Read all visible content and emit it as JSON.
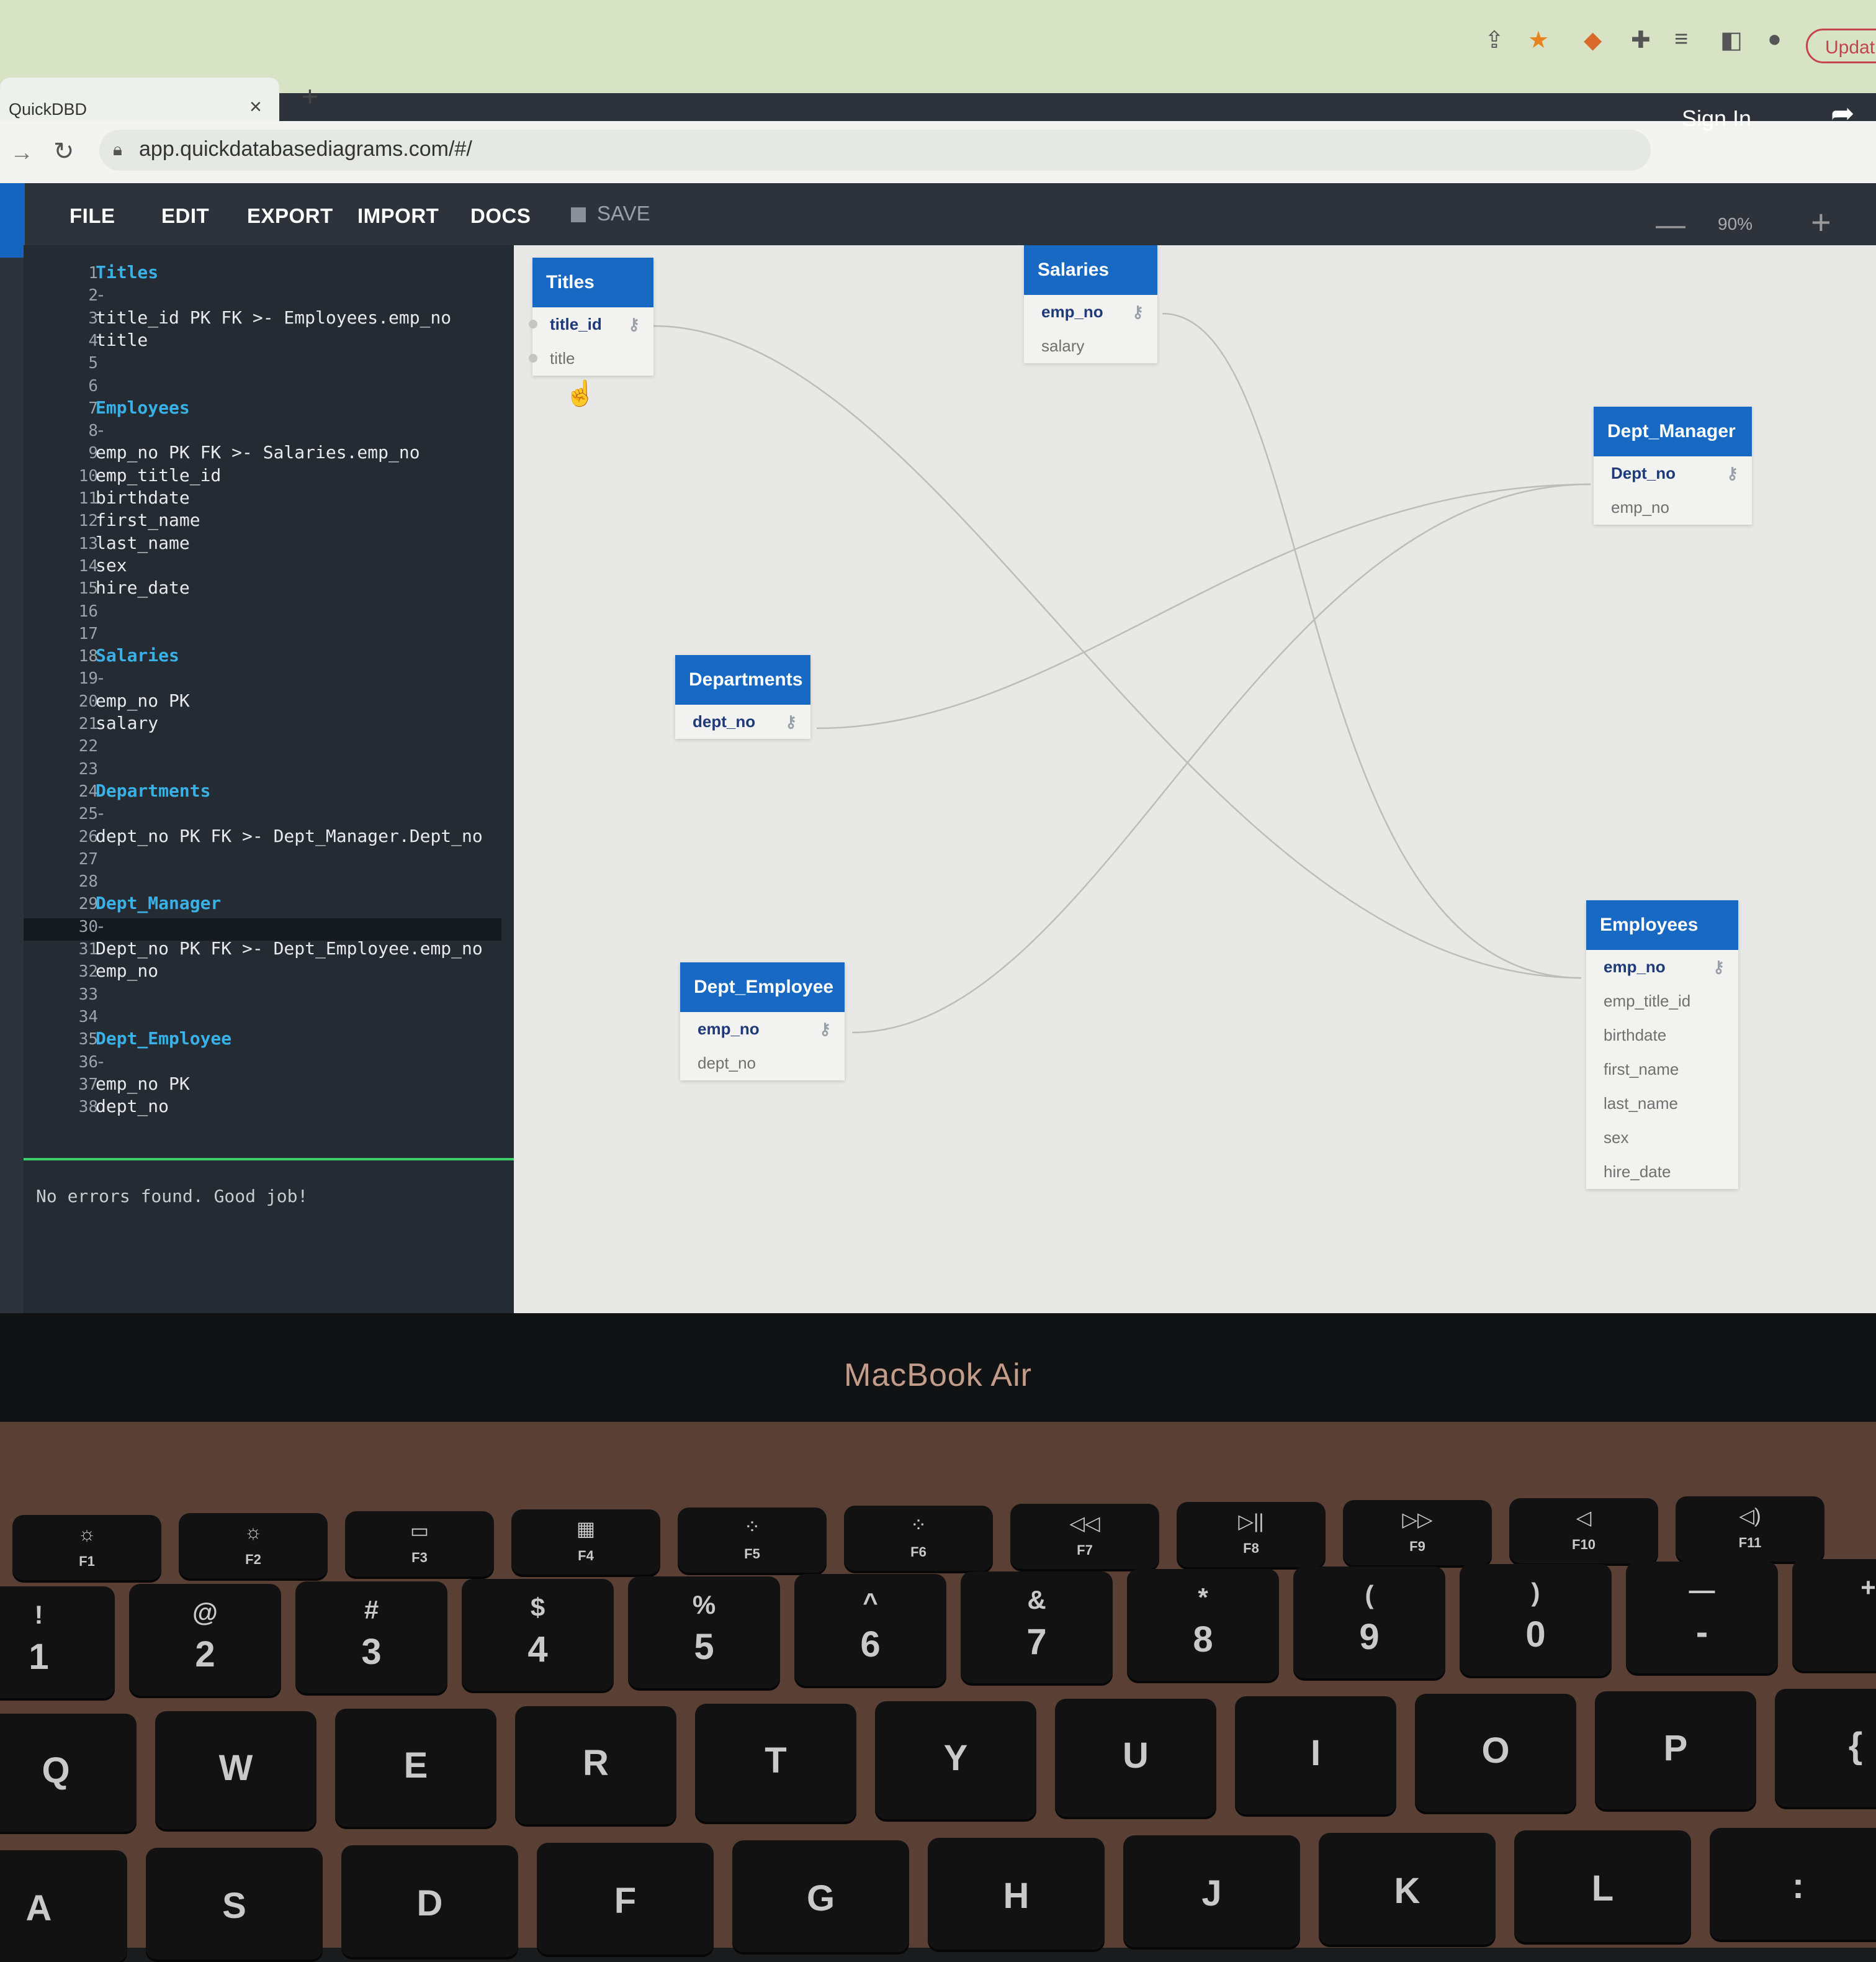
{
  "browser": {
    "tab_title": "QuickDBD",
    "tab_close": "×",
    "new_tab": "+",
    "url": "app.quickdatabasediagrams.com/#/",
    "update_label": "Updat"
  },
  "app": {
    "menu": {
      "file": "FILE",
      "edit": "EDIT",
      "export": "EXPORT",
      "import": "IMPORT",
      "docs": "DOCS",
      "save": "SAVE"
    },
    "sign_in": "Sign In",
    "zoom": {
      "level": "90%",
      "minus": "—",
      "plus": "+"
    }
  },
  "editor": {
    "lines": [
      {
        "n": "1",
        "text": "Titles",
        "type": "table"
      },
      {
        "n": "2",
        "text": "-",
        "type": "dim"
      },
      {
        "n": "3",
        "text": "title_id PK FK >- Employees.emp_no",
        "type": "code"
      },
      {
        "n": "4",
        "text": "title",
        "type": "code"
      },
      {
        "n": "5",
        "text": "",
        "type": "code"
      },
      {
        "n": "6",
        "text": "",
        "type": "code"
      },
      {
        "n": "7",
        "text": "Employees",
        "type": "table"
      },
      {
        "n": "8",
        "text": "-",
        "type": "dim"
      },
      {
        "n": "9",
        "text": "emp_no PK FK >- Salaries.emp_no",
        "type": "code"
      },
      {
        "n": "10",
        "text": "emp_title_id",
        "type": "code"
      },
      {
        "n": "11",
        "text": "birthdate",
        "type": "code"
      },
      {
        "n": "12",
        "text": "first_name",
        "type": "code"
      },
      {
        "n": "13",
        "text": "last_name",
        "type": "code"
      },
      {
        "n": "14",
        "text": "sex",
        "type": "code"
      },
      {
        "n": "15",
        "text": "hire_date",
        "type": "code"
      },
      {
        "n": "16",
        "text": "",
        "type": "code"
      },
      {
        "n": "17",
        "text": "",
        "type": "code"
      },
      {
        "n": "18",
        "text": "Salaries",
        "type": "table"
      },
      {
        "n": "19",
        "text": "-",
        "type": "dim"
      },
      {
        "n": "20",
        "text": "emp_no PK",
        "type": "code"
      },
      {
        "n": "21",
        "text": "salary",
        "type": "code"
      },
      {
        "n": "22",
        "text": "",
        "type": "code"
      },
      {
        "n": "23",
        "text": "",
        "type": "code"
      },
      {
        "n": "24",
        "text": "Departments",
        "type": "table"
      },
      {
        "n": "25",
        "text": "-",
        "type": "dim"
      },
      {
        "n": "26",
        "text": "dept_no PK FK >- Dept_Manager.Dept_no",
        "type": "code"
      },
      {
        "n": "27",
        "text": "",
        "type": "code"
      },
      {
        "n": "28",
        "text": "",
        "type": "code"
      },
      {
        "n": "29",
        "text": "Dept_Manager",
        "type": "table"
      },
      {
        "n": "30",
        "text": "-",
        "type": "dim"
      },
      {
        "n": "31",
        "text": "Dept_no PK FK >- Dept_Employee.emp_no",
        "type": "code"
      },
      {
        "n": "32",
        "text": "emp_no",
        "type": "code"
      },
      {
        "n": "33",
        "text": "",
        "type": "code"
      },
      {
        "n": "34",
        "text": "",
        "type": "code"
      },
      {
        "n": "35",
        "text": "Dept_Employee",
        "type": "table"
      },
      {
        "n": "36",
        "text": "-",
        "type": "dim"
      },
      {
        "n": "37",
        "text": "emp_no PK",
        "type": "code"
      },
      {
        "n": "38",
        "text": "dept_no",
        "type": "code"
      }
    ],
    "status": "No errors found. Good job!"
  },
  "diagram": {
    "titles": {
      "name": "Titles",
      "fields": [
        {
          "name": "title_id",
          "pk": true
        },
        {
          "name": "title",
          "pk": false
        }
      ]
    },
    "salaries": {
      "name": "Salaries",
      "fields": [
        {
          "name": "emp_no",
          "pk": true
        },
        {
          "name": "salary",
          "pk": false
        }
      ]
    },
    "dept_manager": {
      "name": "Dept_Manager",
      "fields": [
        {
          "name": "Dept_no",
          "pk": true
        },
        {
          "name": "emp_no",
          "pk": false
        }
      ]
    },
    "departments": {
      "name": "Departments",
      "fields": [
        {
          "name": "dept_no",
          "pk": true
        }
      ]
    },
    "dept_employee": {
      "name": "Dept_Employee",
      "fields": [
        {
          "name": "emp_no",
          "pk": true
        },
        {
          "name": "dept_no",
          "pk": false
        }
      ]
    },
    "employees": {
      "name": "Employees",
      "fields": [
        {
          "name": "emp_no",
          "pk": true
        },
        {
          "name": "emp_title_id",
          "pk": false
        },
        {
          "name": "birthdate",
          "pk": false
        },
        {
          "name": "first_name",
          "pk": false
        },
        {
          "name": "last_name",
          "pk": false
        },
        {
          "name": "sex",
          "pk": false
        },
        {
          "name": "hire_date",
          "pk": false
        }
      ]
    }
  },
  "laptop": {
    "brand": "MacBook Air",
    "fn_keys": [
      "F1",
      "F2",
      "F3",
      "F4",
      "F5",
      "F6",
      "F7",
      "F8",
      "F9",
      "F10",
      "F11"
    ],
    "fn_glyphs": [
      "☼",
      "☼",
      "▭",
      "▦",
      "⁘",
      "⁘",
      "◁◁",
      "▷||",
      "▷▷",
      "◁",
      "◁)"
    ],
    "number_keys": [
      {
        "top": "!",
        "main": "1"
      },
      {
        "top": "@",
        "main": "2"
      },
      {
        "top": "#",
        "main": "3"
      },
      {
        "top": "$",
        "main": "4"
      },
      {
        "top": "%",
        "main": "5"
      },
      {
        "top": "^",
        "main": "6"
      },
      {
        "top": "&",
        "main": "7"
      },
      {
        "top": "*",
        "main": "8"
      },
      {
        "top": "(",
        "main": "9"
      },
      {
        "top": ")",
        "main": "0"
      },
      {
        "top": "—",
        "main": "-"
      },
      {
        "top": "+",
        "main": ""
      }
    ],
    "qwerty_keys": [
      "Q",
      "W",
      "E",
      "R",
      "T",
      "Y",
      "U",
      "I",
      "O",
      "P",
      "{"
    ],
    "home_keys": [
      "A",
      "S",
      "D",
      "F",
      "G",
      "H",
      "J",
      "K",
      "L",
      ":"
    ]
  }
}
